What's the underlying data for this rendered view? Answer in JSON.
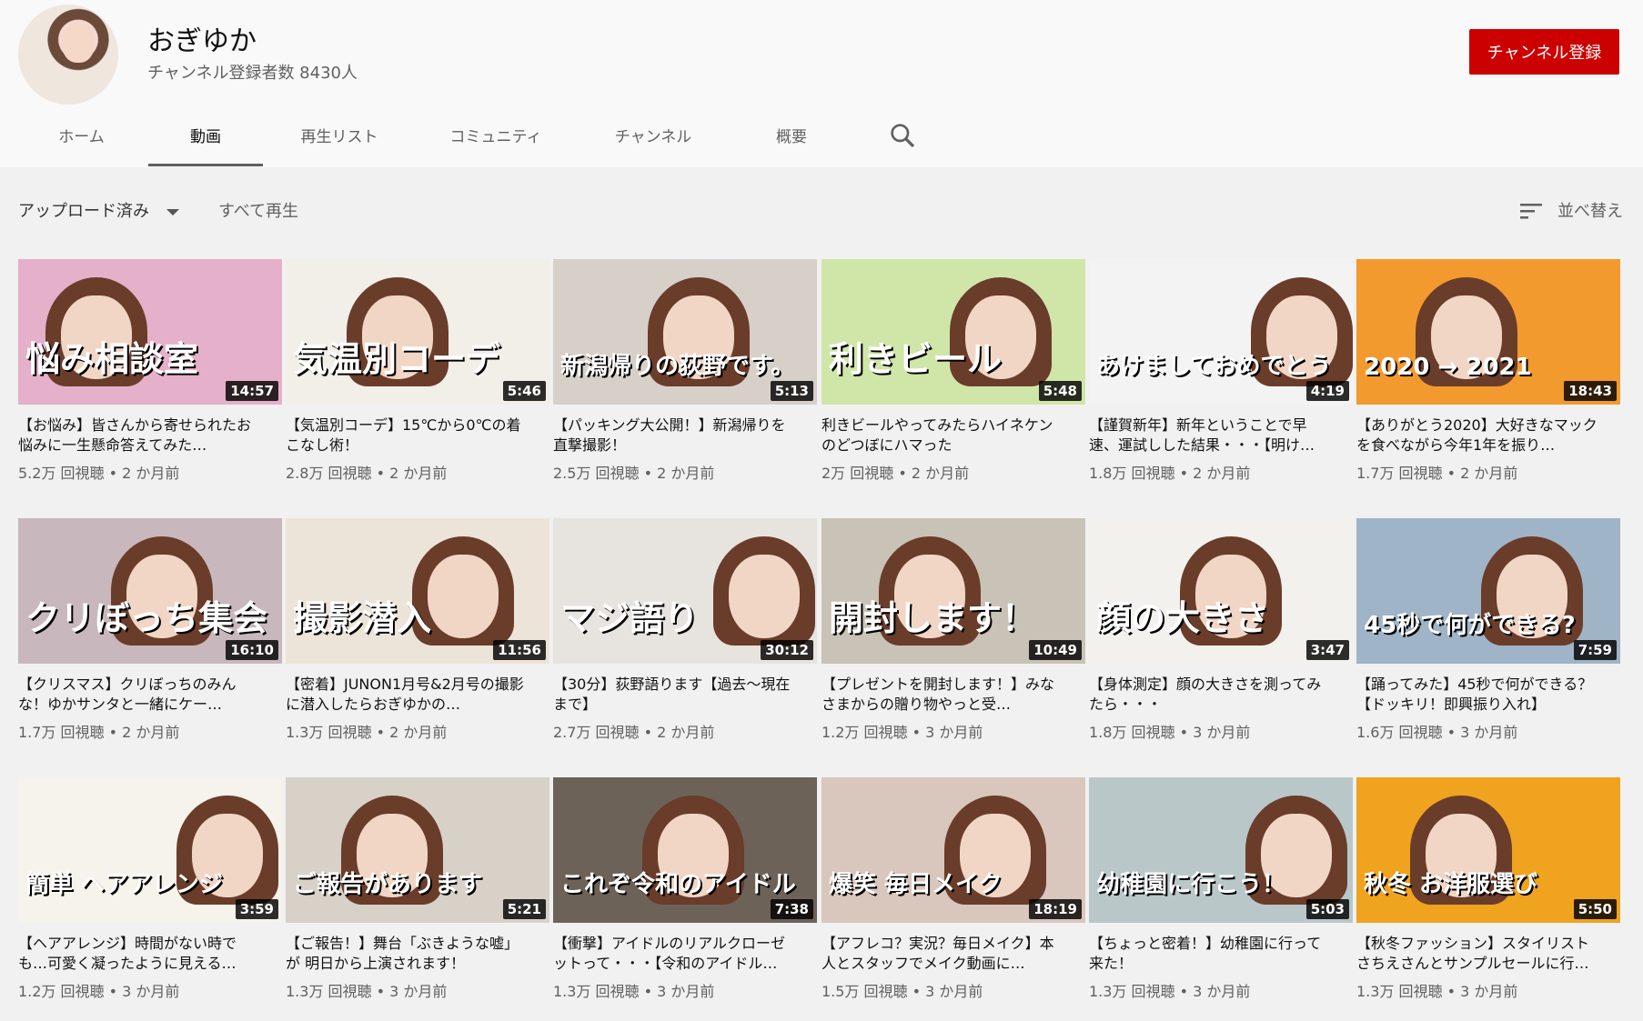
{
  "channel": {
    "name": "おぎゆか",
    "subscribers": "チャンネル登録者数 8430人",
    "subscribe_label": "チャンネル登録"
  },
  "tabs": [
    {
      "label": "ホーム",
      "active": false
    },
    {
      "label": "動画",
      "active": true
    },
    {
      "label": "再生リスト",
      "active": false
    },
    {
      "label": "コミュニティ",
      "active": false
    },
    {
      "label": "チャンネル",
      "active": false
    },
    {
      "label": "概要",
      "active": false
    }
  ],
  "filters": {
    "uploaded": "アップロード済み",
    "play_all": "すべて再生",
    "sort": "並べ替え"
  },
  "icons": {
    "search": "search-icon",
    "sort": "sort-icon",
    "dropdown": "caret-down-icon"
  },
  "videos": [
    {
      "thumb_text": "悩み相談室",
      "duration": "14:57",
      "title": "【お悩み】皆さんから寄せられたお悩みに一生懸命答えてみた…",
      "views": "5.2万 回視聴",
      "age": "2 か月前",
      "bg": "#e5b0c9"
    },
    {
      "thumb_text": "気温別コーデ",
      "duration": "5:46",
      "title": "【気温別コーデ】15℃から0℃の着こなし術！",
      "views": "2.8万 回視聴",
      "age": "2 か月前",
      "bg": "#f2eee8"
    },
    {
      "thumb_text": "新潟帰りの荻野です。",
      "duration": "5:13",
      "title": "【パッキング大公開！】新潟帰りを直撃撮影！",
      "views": "2.5万 回視聴",
      "age": "2 か月前",
      "bg": "#d7d0c8"
    },
    {
      "thumb_text": "利きビール",
      "duration": "5:48",
      "title": "利きビールやってみたらハイネケンのどつぼにハマった",
      "views": "2万 回視聴",
      "age": "2 か月前",
      "bg": "#cfe6a8"
    },
    {
      "thumb_text": "あけましておめでとう",
      "duration": "4:19",
      "title": "【謹賀新年】新年ということで早速、運試しした結果・・・【明け…",
      "views": "1.8万 回視聴",
      "age": "2 か月前",
      "bg": "#f3f3f3"
    },
    {
      "thumb_text": "2020 → 2021",
      "duration": "18:43",
      "title": "【ありがとう2020】大好きなマックを食べながら今年1年を振り…",
      "views": "1.7万 回視聴",
      "age": "2 か月前",
      "bg": "#f39a2e"
    },
    {
      "thumb_text": "クリぼっち集会",
      "duration": "16:10",
      "title": "【クリスマス】クリぼっちのみんな！ゆかサンタと一緒にケー…",
      "views": "1.7万 回視聴",
      "age": "2 か月前",
      "bg": "#c8b8bd"
    },
    {
      "thumb_text": "撮影潜入",
      "duration": "11:56",
      "title": "【密着】JUNON1月号&2月号の撮影に潜入したらおぎゆかの…",
      "views": "1.3万 回視聴",
      "age": "2 か月前",
      "bg": "#ece4d8"
    },
    {
      "thumb_text": "マジ語り",
      "duration": "30:12",
      "title": "【30分】荻野語ります【過去〜現在まで】",
      "views": "2.7万 回視聴",
      "age": "2 か月前",
      "bg": "#e7e3df"
    },
    {
      "thumb_text": "開封します！",
      "duration": "10:49",
      "title": "【プレゼントを開封します！】みなさまからの贈り物やっと受…",
      "views": "1.2万 回視聴",
      "age": "3 か月前",
      "bg": "#c9c2b6"
    },
    {
      "thumb_text": "顔の大きさ",
      "duration": "3:47",
      "title": "【身体測定】顔の大きさを測ってみたら・・・",
      "views": "1.8万 回視聴",
      "age": "3 か月前",
      "bg": "#f2f1ee"
    },
    {
      "thumb_text": "45秒で何ができる?",
      "duration": "7:59",
      "title": "【踊ってみた】45秒で何ができる？【ドッキリ！即興振り入れ】",
      "views": "1.6万 回視聴",
      "age": "3 か月前",
      "bg": "#9fb4c6"
    },
    {
      "thumb_text": "簡単 ヘアアレンジ",
      "duration": "3:59",
      "title": "【ヘアアレンジ】時間がない時でも…可愛く凝ったように見える…",
      "views": "1.2万 回視聴",
      "age": "3 か月前",
      "bg": "#f6f2ec"
    },
    {
      "thumb_text": "ご報告があります",
      "duration": "5:21",
      "title": "【ご報告！】舞台「ぶきような嘘」が 明日から上演されます！",
      "views": "1.3万 回視聴",
      "age": "3 か月前",
      "bg": "#d8d1c8"
    },
    {
      "thumb_text": "これぞ令和のアイドル",
      "duration": "7:38",
      "title": "【衝撃】アイドルのリアルクローゼットって・・・【令和のアイドル…",
      "views": "1.3万 回視聴",
      "age": "3 か月前",
      "bg": "#6d6258"
    },
    {
      "thumb_text": "爆笑 毎日メイク",
      "duration": "18:19",
      "title": "【アフレコ？実況？毎日メイク】本人とスタッフでメイク動画に…",
      "views": "1.5万 回視聴",
      "age": "3 か月前",
      "bg": "#d9c6bd"
    },
    {
      "thumb_text": "幼稚園に行こう！",
      "duration": "5:03",
      "title": "【ちょっと密着！】幼稚園に行って来た！",
      "views": "1.3万 回視聴",
      "age": "3 か月前",
      "bg": "#b9c7c9"
    },
    {
      "thumb_text": "秋冬 お洋服選び",
      "duration": "5:50",
      "title": "【秋冬ファッション】スタイリストさちえさんとサンプルセールに行…",
      "views": "1.3万 回視聴",
      "age": "3 か月前",
      "bg": "#efa31f"
    }
  ]
}
